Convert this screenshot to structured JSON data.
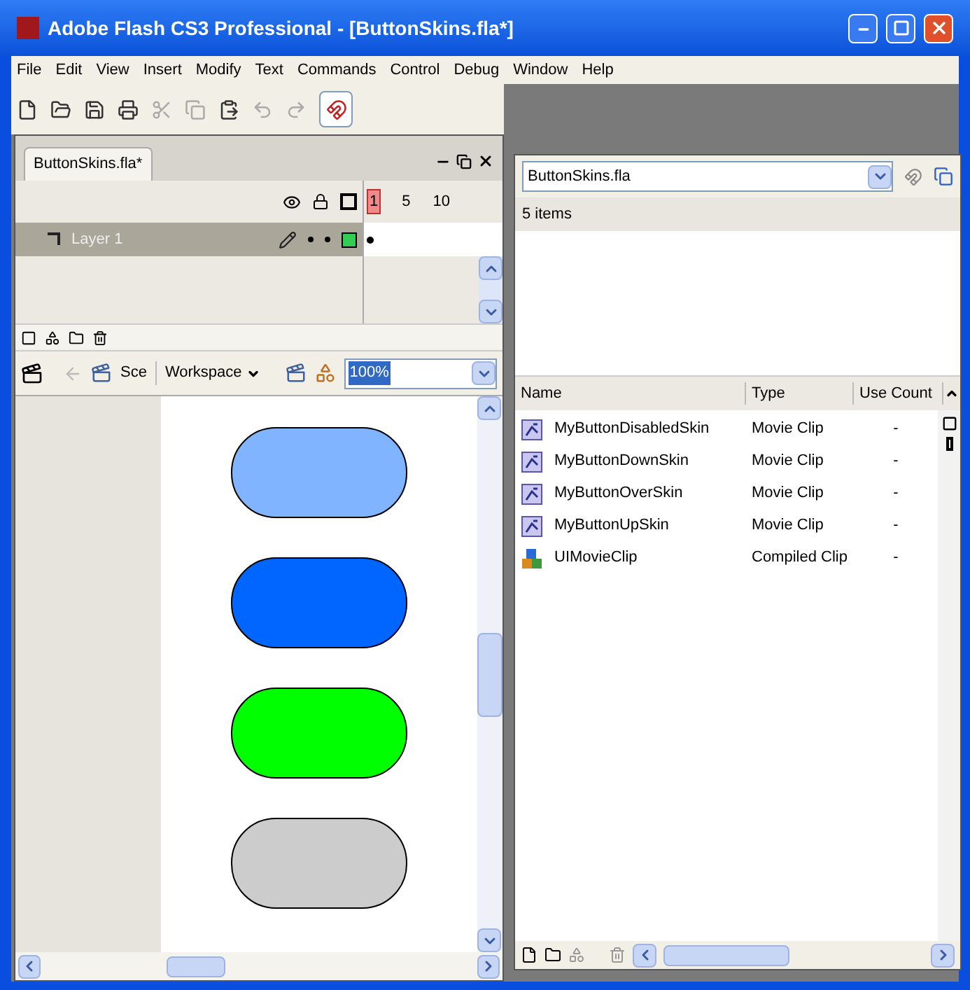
{
  "window": {
    "title": "Adobe Flash CS3 Professional - [ButtonSkins.fla*]"
  },
  "menu": [
    "File",
    "Edit",
    "View",
    "Insert",
    "Modify",
    "Text",
    "Commands",
    "Control",
    "Debug",
    "Window",
    "Help"
  ],
  "document_tab": {
    "label": "ButtonSkins.fla*",
    "selected": true
  },
  "timeline": {
    "frame_numbers": [
      {
        "label": "1",
        "selected": true
      },
      {
        "label": "5",
        "selected": false
      },
      {
        "label": "10",
        "selected": false
      }
    ],
    "layers": [
      {
        "name": "Layer 1",
        "selected": true
      }
    ]
  },
  "edit_bar": {
    "scene": "Sce",
    "workspace": "Workspace",
    "zoom": "100%"
  },
  "stage": {
    "shapes": [
      {
        "color": "#80b4ff"
      },
      {
        "color": "#0066ff"
      },
      {
        "color": "#00ff00"
      },
      {
        "color": "#cccccc"
      }
    ]
  },
  "library": {
    "document": "ButtonSkins.fla",
    "count": "5 items",
    "columns": [
      "Name",
      "Type",
      "Use Count"
    ],
    "rows": [
      {
        "kind": "movie_clip",
        "name": "MyButtonDisabledSkin",
        "type": "Movie Clip",
        "use_count": "-"
      },
      {
        "kind": "movie_clip",
        "name": "MyButtonDownSkin",
        "type": "Movie Clip",
        "use_count": "-"
      },
      {
        "kind": "movie_clip",
        "name": "MyButtonOverSkin",
        "type": "Movie Clip",
        "use_count": "-"
      },
      {
        "kind": "movie_clip",
        "name": "MyButtonUpSkin",
        "type": "Movie Clip",
        "use_count": "-"
      },
      {
        "kind": "compiled_clip",
        "name": "UIMovieClip",
        "type": "Compiled Clip",
        "use_count": "-"
      }
    ]
  }
}
